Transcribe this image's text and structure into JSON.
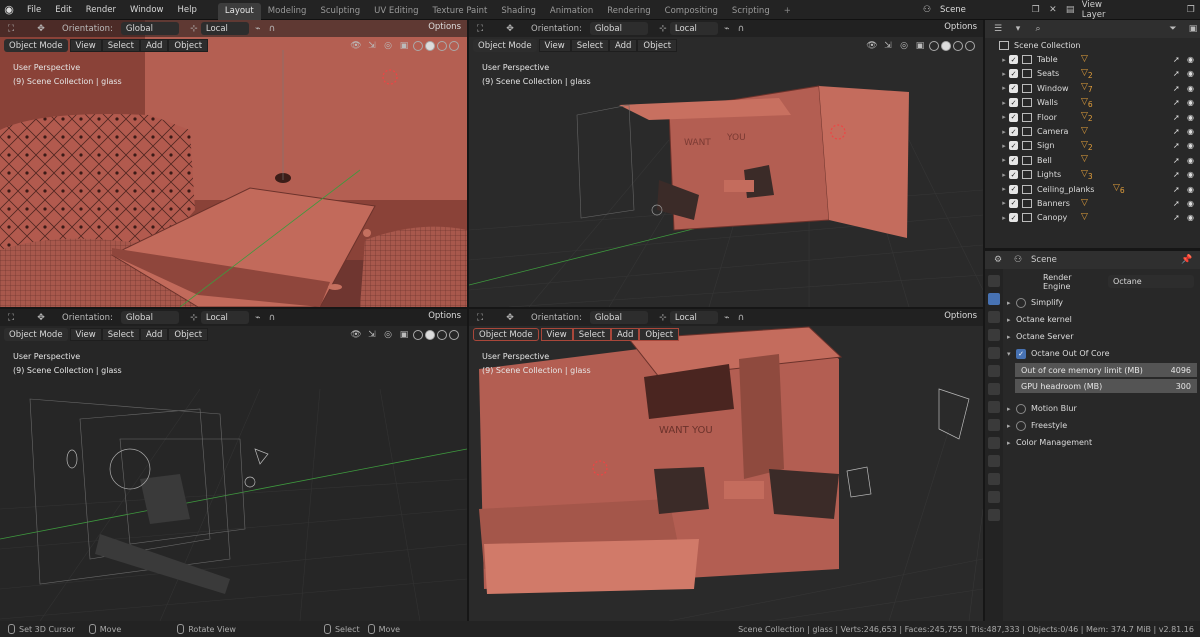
{
  "menu": {
    "items": [
      "File",
      "Edit",
      "Render",
      "Window",
      "Help"
    ]
  },
  "workspaces": {
    "tabs": [
      "Layout",
      "Modeling",
      "Sculpting",
      "UV Editing",
      "Texture Paint",
      "Shading",
      "Animation",
      "Rendering",
      "Compositing",
      "Scripting"
    ],
    "active": "Layout"
  },
  "scene": {
    "value": "Scene"
  },
  "view_layer": {
    "value": "View Layer"
  },
  "viewport": {
    "orientation_label": "Orientation:",
    "orientation_value": "Global",
    "pivot_value": "Local",
    "options_label": "Options",
    "mode": "Object Mode",
    "view_label": "View",
    "select_label": "Select",
    "add_label": "Add",
    "object_label": "Object",
    "perspective": "User Perspective",
    "collection_info": "(9) Scene Collection | glass"
  },
  "viewport_br_texts": {
    "sign": "WANT YOU",
    "sign2": "WANT",
    "sign3": "YOU"
  },
  "outliner": {
    "root": "Scene Collection",
    "items": [
      {
        "name": "Table",
        "badge": ""
      },
      {
        "name": "Seats",
        "badge": "2"
      },
      {
        "name": "Window",
        "badge": "7"
      },
      {
        "name": "Walls",
        "badge": "6"
      },
      {
        "name": "Floor",
        "badge": "2"
      },
      {
        "name": "Camera",
        "badge": ""
      },
      {
        "name": "Sign",
        "badge": "2"
      },
      {
        "name": "Bell",
        "badge": ""
      },
      {
        "name": "Lights",
        "badge": "3"
      },
      {
        "name": "Ceiling_planks",
        "badge": "6"
      },
      {
        "name": "Banners",
        "badge": ""
      },
      {
        "name": "Canopy",
        "badge": ""
      }
    ]
  },
  "properties": {
    "context": "Scene",
    "render_engine_label": "Render Engine",
    "render_engine_value": "Octane",
    "panels": [
      "Simplify",
      "Octane kernel",
      "Octane Server",
      "Octane Out Of Core"
    ],
    "ooc_memory_label": "Out of core memory limit (MB)",
    "ooc_memory_value": "4096",
    "gpu_headroom_label": "GPU headroom (MB)",
    "gpu_headroom_value": "300",
    "panels2": [
      "Motion Blur",
      "Freestyle",
      "Color Management"
    ]
  },
  "statusbar": {
    "set_cursor": "Set 3D Cursor",
    "move": "Move",
    "rotate": "Rotate View",
    "select": "Select",
    "move2": "Move",
    "stats": "Scene Collection | glass | Verts:246,653 | Faces:245,755 | Tris:487,333 | Objects:0/46 | Mem: 374.7 MiB | v2.81.16"
  }
}
